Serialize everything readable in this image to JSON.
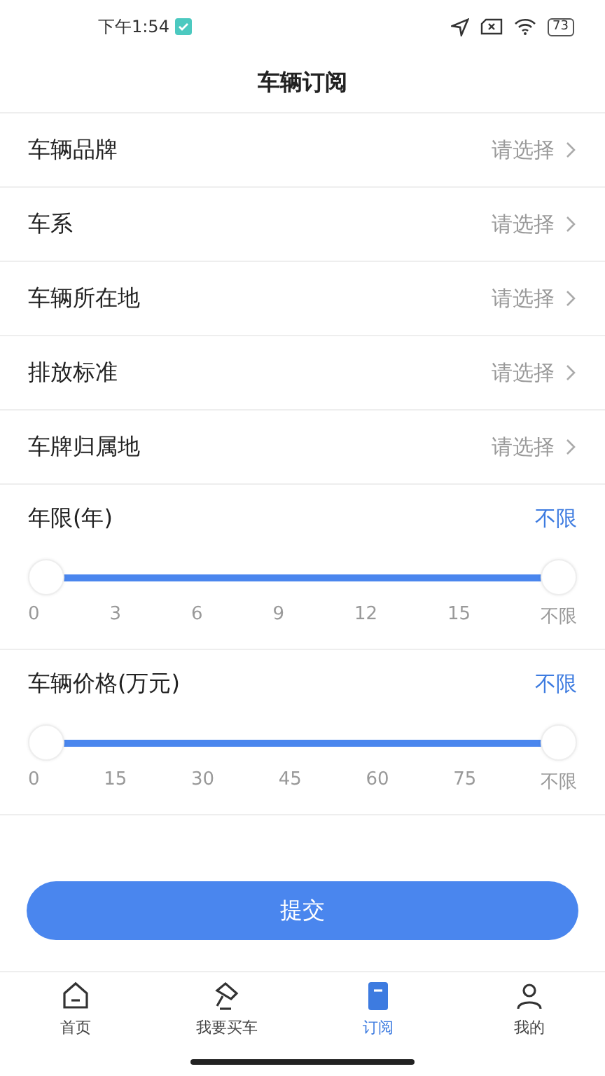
{
  "status_bar": {
    "time": "下午1:54",
    "battery": "73"
  },
  "title": "车辆订阅",
  "pickers": [
    {
      "label": "车辆品牌",
      "value": "请选择"
    },
    {
      "label": "车系",
      "value": "请选择"
    },
    {
      "label": "车辆所在地",
      "value": "请选择"
    },
    {
      "label": "排放标准",
      "value": "请选择"
    },
    {
      "label": "车牌归属地",
      "value": "请选择"
    }
  ],
  "ranges": [
    {
      "label": "年限(年)",
      "reading": "不限",
      "level": 1,
      "ticks": [
        "0",
        "3",
        "6",
        "9",
        "12",
        "15",
        "不限"
      ]
    },
    {
      "label": "车辆价格(万元)",
      "reading": "不限",
      "level": 1,
      "ticks": [
        "0",
        "15",
        "30",
        "45",
        "60",
        "75",
        "不限"
      ]
    }
  ],
  "submit": "提交",
  "nav": [
    {
      "label": "首页",
      "kind": "home",
      "selected": false
    },
    {
      "label": "我要买车",
      "kind": "buy",
      "selected": false
    },
    {
      "label": "订阅",
      "kind": "subscribe",
      "selected": true
    },
    {
      "label": "我的",
      "kind": "me",
      "selected": false
    }
  ]
}
